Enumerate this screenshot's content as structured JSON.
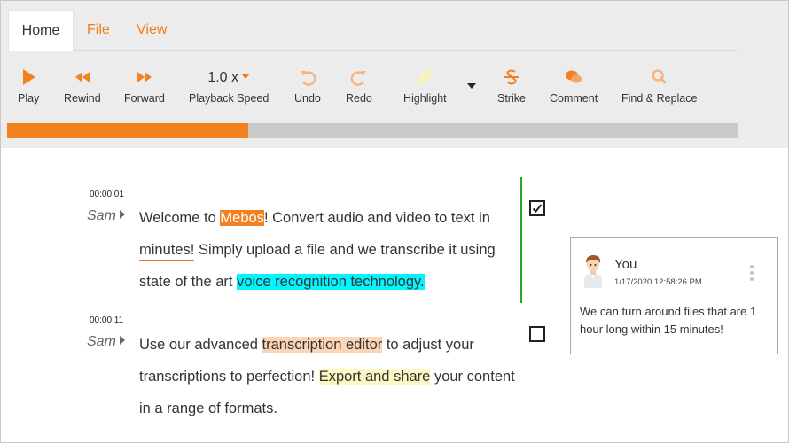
{
  "tabs": {
    "home": "Home",
    "file": "File",
    "view": "View"
  },
  "toolbar": {
    "play": "Play",
    "rewind": "Rewind",
    "forward": "Forward",
    "speed_value": "1.0 x",
    "speed_label": "Playback Speed",
    "undo": "Undo",
    "redo": "Redo",
    "highlight": "Highlight",
    "strike": "Strike",
    "comment": "Comment",
    "find_replace": "Find & Replace"
  },
  "progress": {
    "percent": 33
  },
  "transcript": [
    {
      "time": "00:00:01",
      "speaker": "Sam",
      "line1_pre": "Welcome to ",
      "line1_hl": "Mebos",
      "line1_post": "! Convert audio and video to text in",
      "line2_ul": "minutes!",
      "line2_post": "  Simply upload a file and we transcribe it using",
      "line3_pre": "state of the art ",
      "line3_hl": "voice recognition technology.",
      "checked": true
    },
    {
      "time": "00:00:11",
      "speaker": "Sam",
      "line1_pre": "Use our advanced ",
      "line1_hl": "transcription editor",
      "line1_post": " to adjust your",
      "line2_pre": "transcriptions to perfection!  ",
      "line2_hl": "Export and share",
      "line2_post": " your content",
      "line3": "in a range of formats.",
      "checked": false
    }
  ],
  "comment": {
    "author": "You",
    "date": "1/17/2020 12:58:26 PM",
    "text": "We can turn around files that are 1 hour long within 15 minutes!"
  },
  "colors": {
    "accent": "#f07d1e",
    "progress_fill": "#f38120",
    "cyan_highlight": "#00f5ff",
    "peach_highlight": "#fbd5b5",
    "yellow_highlight": "#fdf7c4",
    "active_bar": "#2aa52a"
  },
  "icons": {
    "play": "play-icon",
    "rewind": "rewind-icon",
    "forward": "forward-icon",
    "undo": "undo-icon",
    "redo": "redo-icon",
    "highlight": "highlighter-icon",
    "strike": "strikethrough-icon",
    "comment": "comment-icon",
    "find_replace": "search-icon"
  }
}
